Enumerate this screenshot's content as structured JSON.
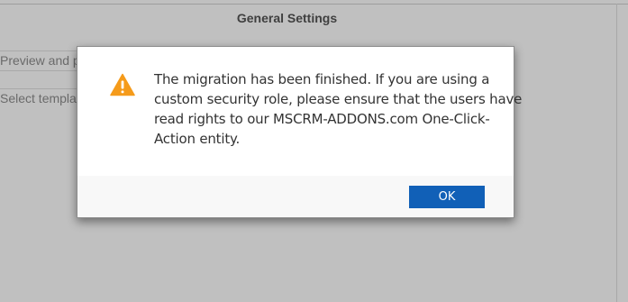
{
  "background": {
    "title": "General Settings",
    "fields": [
      {
        "label": "Preview and p"
      },
      {
        "label": "Select templa"
      }
    ]
  },
  "dialog": {
    "icon": "warning-icon",
    "message_lines": [
      "The migration has been finished. If you are using a",
      "custom security role, please ensure that the users have",
      "read rights to our MSCRM-ADDONS.com One-Click-",
      "Action entity."
    ],
    "ok_label": "OK"
  },
  "colors": {
    "overlay": "#c0c0c0",
    "warning": "#f59b1b",
    "button": "#1160b7"
  }
}
